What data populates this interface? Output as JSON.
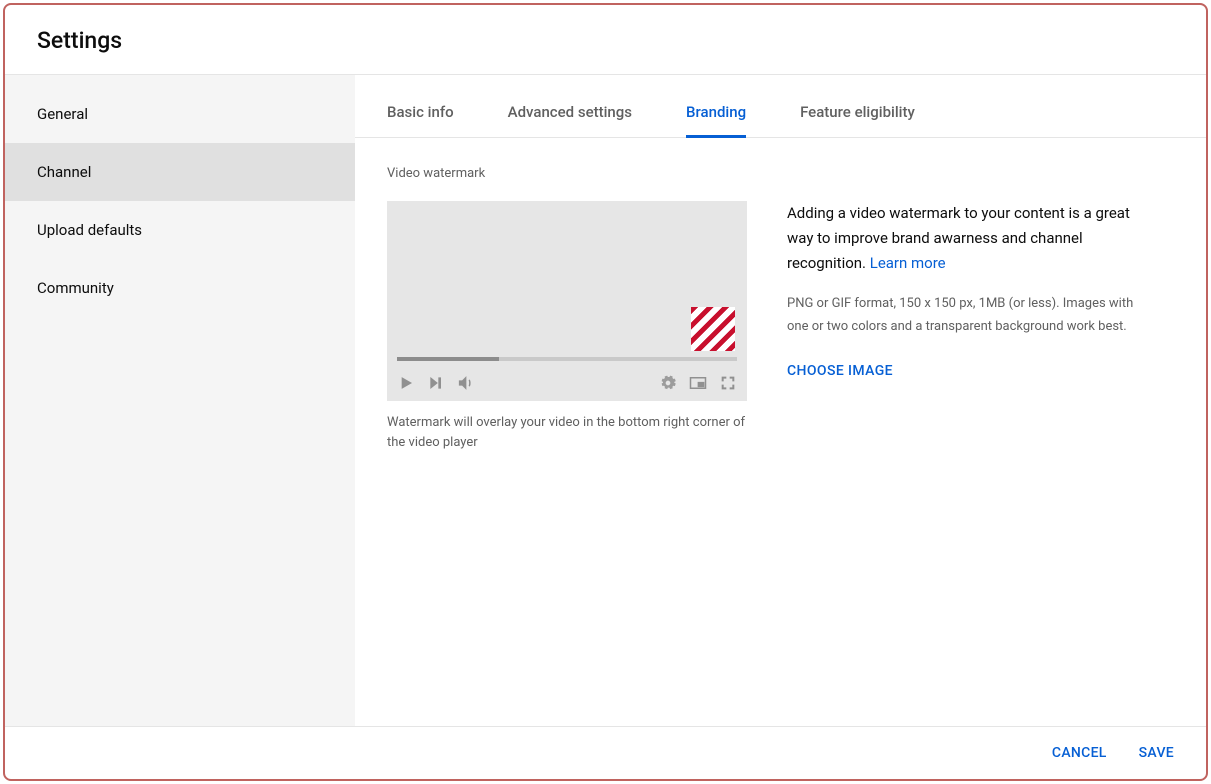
{
  "header": {
    "title": "Settings"
  },
  "sidebar": {
    "items": [
      {
        "label": "General"
      },
      {
        "label": "Channel"
      },
      {
        "label": "Upload defaults"
      },
      {
        "label": "Community"
      }
    ],
    "active_index": 1
  },
  "tabs": {
    "items": [
      {
        "label": "Basic info"
      },
      {
        "label": "Advanced settings"
      },
      {
        "label": "Branding"
      },
      {
        "label": "Feature eligibility"
      }
    ],
    "active_index": 2
  },
  "branding": {
    "section_title": "Video watermark",
    "preview_caption": "Watermark will overlay your video in the bottom right corner of the video player",
    "description_text": "Adding a video watermark to your content is a great way to improve brand awarness and channel recognition. ",
    "learn_more": "Learn more",
    "format_hint": "PNG or GIF format, 150 x 150 px, 1MB (or less). Images with one or two colors and a transparent background work best.",
    "choose_label": "CHOOSE IMAGE"
  },
  "footer": {
    "cancel": "CANCEL",
    "save": "SAVE"
  }
}
